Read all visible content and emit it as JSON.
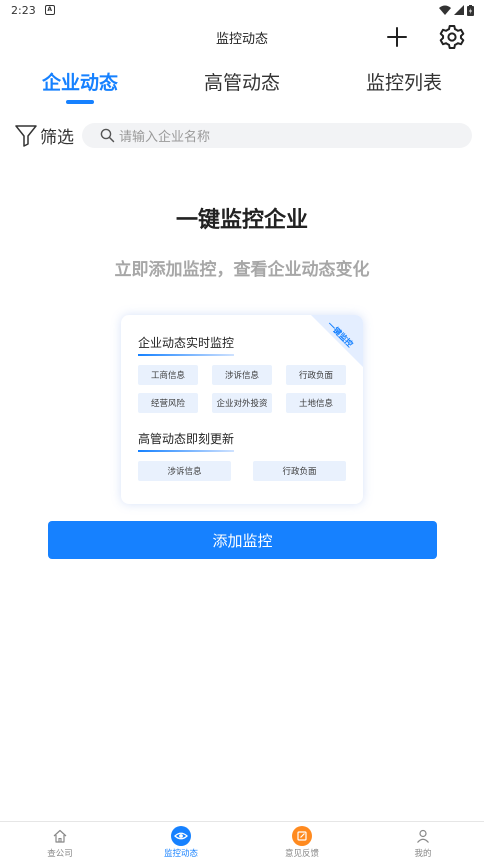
{
  "status_bar": {
    "time": "2:23",
    "notif_letter": "A"
  },
  "header": {
    "title": "监控动态"
  },
  "tabs": [
    {
      "label": "企业动态"
    },
    {
      "label": "高管动态"
    },
    {
      "label": "监控列表"
    }
  ],
  "filter": {
    "label": "筛选"
  },
  "search": {
    "placeholder": "请输入企业名称"
  },
  "hero": {
    "headline": "一键监控企业",
    "subline": "立即添加监控，查看企业动态变化"
  },
  "card": {
    "ribbon": "一键监控",
    "section1": {
      "title": "企业动态实时监控",
      "chips": [
        "工商信息",
        "涉诉信息",
        "行政负面",
        "经营风险",
        "企业对外投资",
        "土地信息"
      ]
    },
    "section2": {
      "title": "高管动态即刻更新",
      "chips": [
        "涉诉信息",
        "行政负面"
      ]
    }
  },
  "add_button": {
    "label": "添加监控"
  },
  "bottom_nav": [
    {
      "label": "查公司"
    },
    {
      "label": "监控动态"
    },
    {
      "label": "意见反馈"
    },
    {
      "label": "我的"
    }
  ],
  "colors": {
    "accent": "#1681ff",
    "feedback": "#ff8a1f",
    "subtle": "#a7a7a7"
  }
}
